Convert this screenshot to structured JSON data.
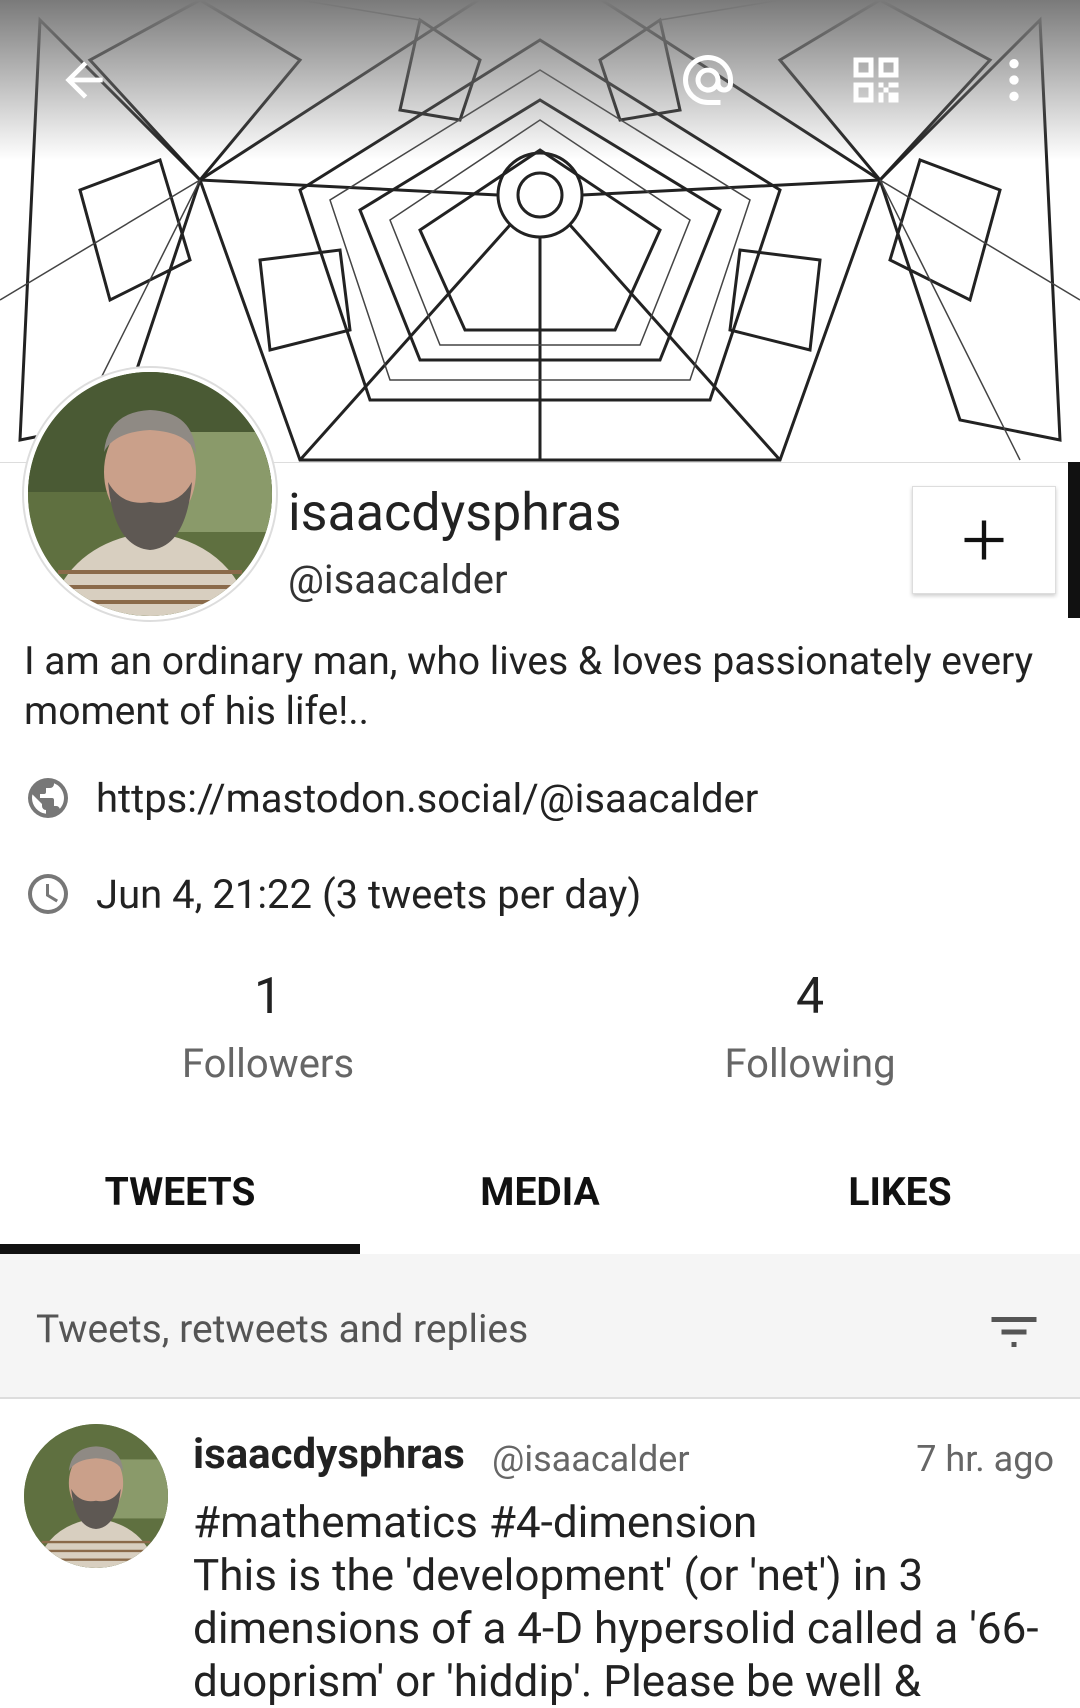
{
  "topbar": {
    "back_icon": "arrow-left-icon",
    "mention_icon": "at-sign-icon",
    "qr_icon": "qr-code-icon",
    "more_icon": "more-vert-icon"
  },
  "profile": {
    "display_name": "isaacdysphras",
    "handle": "@isaacalder",
    "bio": "I am an ordinary man, who lives & loves passionately every moment of his life!..",
    "url": "https://mastodon.social/@isaacalder",
    "joined": "Jun 4, 21:22 (3 tweets per day)"
  },
  "stats": {
    "followers_count": "1",
    "followers_label": "Followers",
    "following_count": "4",
    "following_label": "Following"
  },
  "tabs": [
    {
      "label": "TWEETS",
      "active": true
    },
    {
      "label": "MEDIA",
      "active": false
    },
    {
      "label": "LIKES",
      "active": false
    }
  ],
  "filter": {
    "label": "Tweets, retweets and replies"
  },
  "tweet": {
    "name": "isaacdysphras",
    "handle": "@isaacalder",
    "time": "7 hr. ago",
    "hashtags": "#mathematics #4-dimension",
    "body": "This is the 'development' (or 'net') in 3 dimensions of a 4-D hypersolid called a '66-duoprism' or 'hiddip'. Please be well &"
  }
}
